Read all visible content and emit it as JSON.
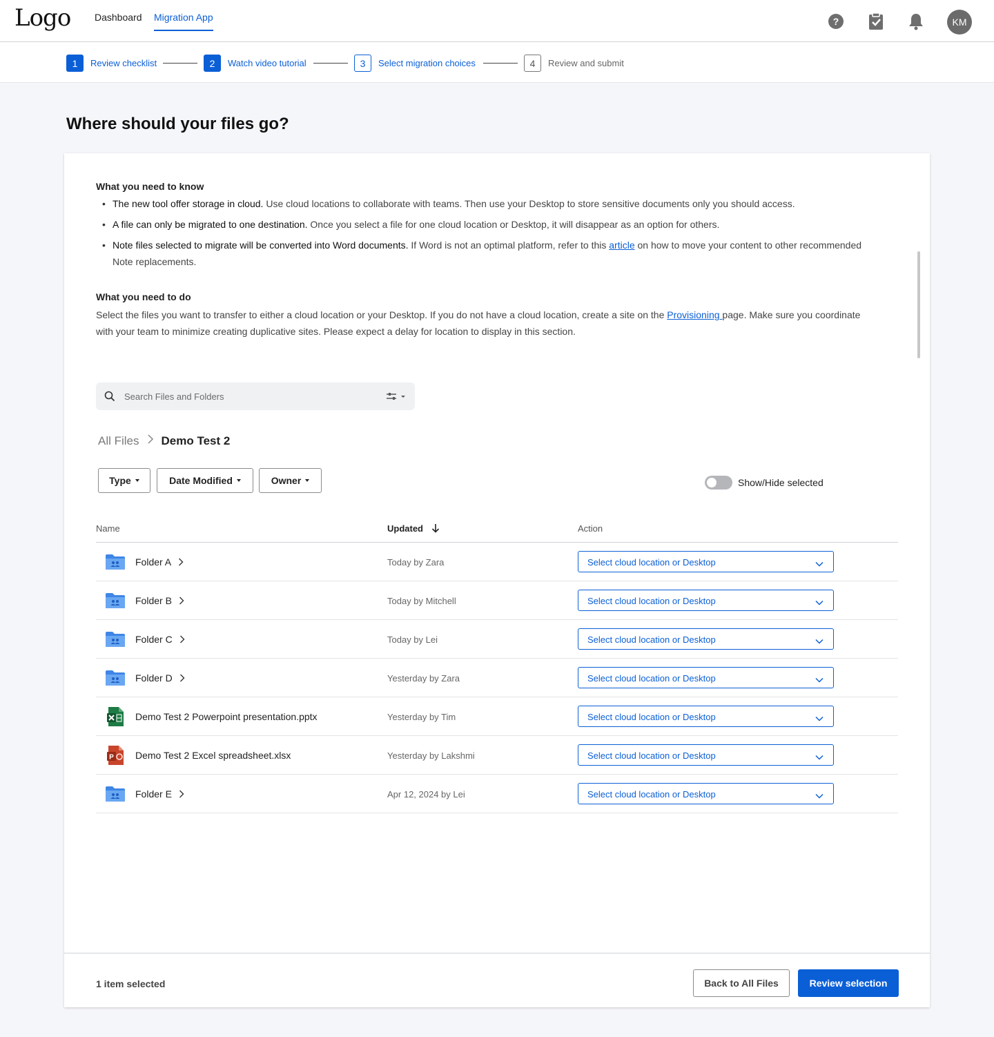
{
  "header": {
    "logo": "Logo",
    "nav": [
      {
        "label": "Dashboard"
      },
      {
        "label": "Migration App"
      }
    ],
    "avatar": "KM"
  },
  "stepper": {
    "steps": [
      {
        "num": "1",
        "label": "Review checklist"
      },
      {
        "num": "2",
        "label": "Watch video tutorial"
      },
      {
        "num": "3",
        "label": "Select migration choices"
      },
      {
        "num": "4",
        "label": "Review and submit"
      }
    ]
  },
  "page": {
    "title": "Where should your files go?"
  },
  "know": {
    "heading": "What you need to know",
    "b1_bold": "The new tool offer storage in cloud.",
    "b1_rest": " Use cloud locations to collaborate with teams. Then use your Desktop to store sensitive documents only you should access.",
    "b2_bold": "A file can only be migrated to one destination.",
    "b2_rest": " Once you select a file for one cloud location or Desktop, it will disappear as an option for others.",
    "b3_bold": "Note files selected to migrate will be converted into Word documents.",
    "b3_pre": " If Word is not an optimal platform, refer to this ",
    "b3_link": "article",
    "b3_post": " on how to move your content to other recommended Note replacements."
  },
  "todo": {
    "heading": "What you need to do",
    "pre": "Select the files you want to transfer to either a cloud location or your Desktop. If you do not have a cloud location, create a site on the ",
    "link": "Provisioning ",
    "post": "page. Make sure you coordinate with your team to minimize creating duplicative sites. Please expect a delay for location to display in this section."
  },
  "search": {
    "placeholder": "Search Files and Folders"
  },
  "breadcrumb": {
    "root": "All Files",
    "current": "Demo Test 2"
  },
  "filters": {
    "type": "Type",
    "date": "Date Modified",
    "owner": "Owner"
  },
  "toggle": {
    "label": "Show/Hide selected",
    "on": false
  },
  "table": {
    "col_name": "Name",
    "col_updated": "Updated",
    "col_action": "Action",
    "rows": [
      {
        "name": "Folder A",
        "updated": "Today by Zara",
        "action": "Select cloud location or Desktop",
        "icon": "folder-shared-icon"
      },
      {
        "name": "Folder B",
        "updated": "Today by Mitchell",
        "action": "Select cloud location or Desktop",
        "icon": "folder-shared-icon"
      },
      {
        "name": "Folder C",
        "updated": "Today by Lei",
        "action": "Select cloud location or Desktop",
        "icon": "folder-shared-icon"
      },
      {
        "name": "Folder D",
        "updated": "Yesterday by Zara",
        "action": "Select cloud location or Desktop",
        "icon": "folder-shared-icon"
      },
      {
        "name": "Demo Test 2 Powerpoint presentation.pptx",
        "updated": "Yesterday by Tim",
        "action": "Select cloud location or Desktop",
        "icon": "excel-file-icon"
      },
      {
        "name": "Demo Test 2 Excel spreadsheet.xlsx",
        "updated": "Yesterday by Lakshmi",
        "action": "Select cloud location or Desktop",
        "icon": "powerpoint-file-icon"
      },
      {
        "name": "Folder E",
        "updated": "Apr 12, 2024 by Lei",
        "action": "Select cloud location or Desktop",
        "icon": "folder-shared-icon"
      }
    ]
  },
  "footer": {
    "selected": "1 item selected",
    "back": "Back to All Files",
    "review": "Review selection"
  },
  "colors": {
    "accent": "#0b5fd6",
    "folder": "#4a90e8",
    "excel": "#1e7b45",
    "powerpoint": "#c8452b"
  }
}
